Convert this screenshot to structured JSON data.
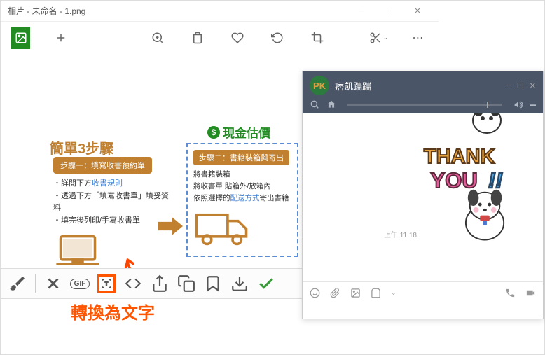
{
  "photoWindow": {
    "title": "相片 - 未命名 - 1.png"
  },
  "content": {
    "stepsTitle": "簡單3步驟",
    "cashLabel": "現金估價",
    "step1": {
      "pill": "步驟一：填寫收書預約單",
      "line1_a": "・詳閱下方",
      "line1_b": "收書規則",
      "line2": "・透過下方「填寫收書單」填妥資料",
      "line3": "・填完後列印/手寫收書單"
    },
    "step2": {
      "pill": "步驟二：書籍裝箱與寄出",
      "line1": "將書籍裝箱",
      "line2": "將收書單 貼箱外/放箱內",
      "line3_a": "依照選擇的",
      "line3_b": "配送方式",
      "line3_c": "寄出書籍"
    }
  },
  "actionBar": {
    "gif": "GIF"
  },
  "convertLabel": "轉換為文字",
  "chat": {
    "contactName": "痞凱踹踹",
    "avatarText": "PK",
    "timestamp": "上午 11:18"
  }
}
